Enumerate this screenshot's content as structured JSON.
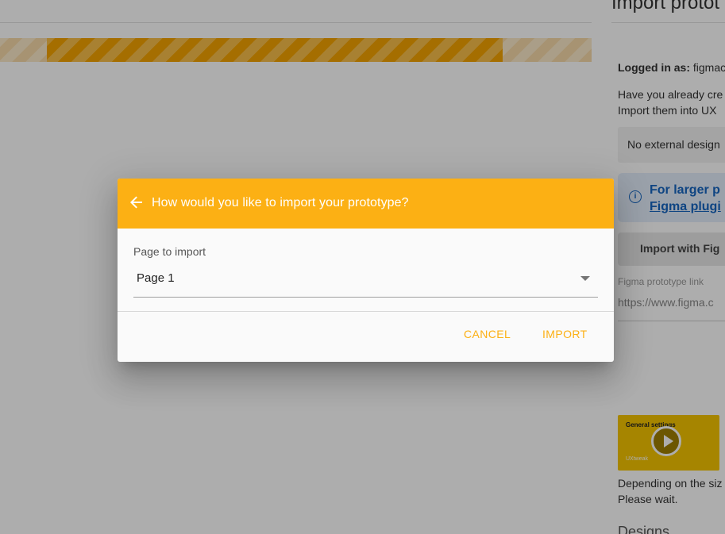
{
  "background": {
    "progress_fraction": 0.85,
    "right_panel": {
      "title": "Import protot",
      "logged_in_label": "Logged in as:",
      "logged_in_value": "figmac",
      "question_line1": "Have you already cre",
      "question_line2": "Import them into UX",
      "external_select": "No external design",
      "info_line1": "For larger p",
      "info_line2": "Figma plugi",
      "figma_button": "Import with Fig",
      "link_label": "Figma prototype link",
      "link_placeholder": "https://www.figma.c",
      "thumb_title": "General settings",
      "thumb_brand": "UXtweak",
      "depending_line1": "Depending on the siz",
      "depending_line2": "Please wait.",
      "designs_heading": "Designs"
    }
  },
  "dialog": {
    "title": "How would you like to import your prototype?",
    "field_label": "Page to import",
    "selected_page": "Page 1",
    "cancel_label": "CANCEL",
    "import_label": "IMPORT",
    "accent_color": "#fcb014"
  }
}
